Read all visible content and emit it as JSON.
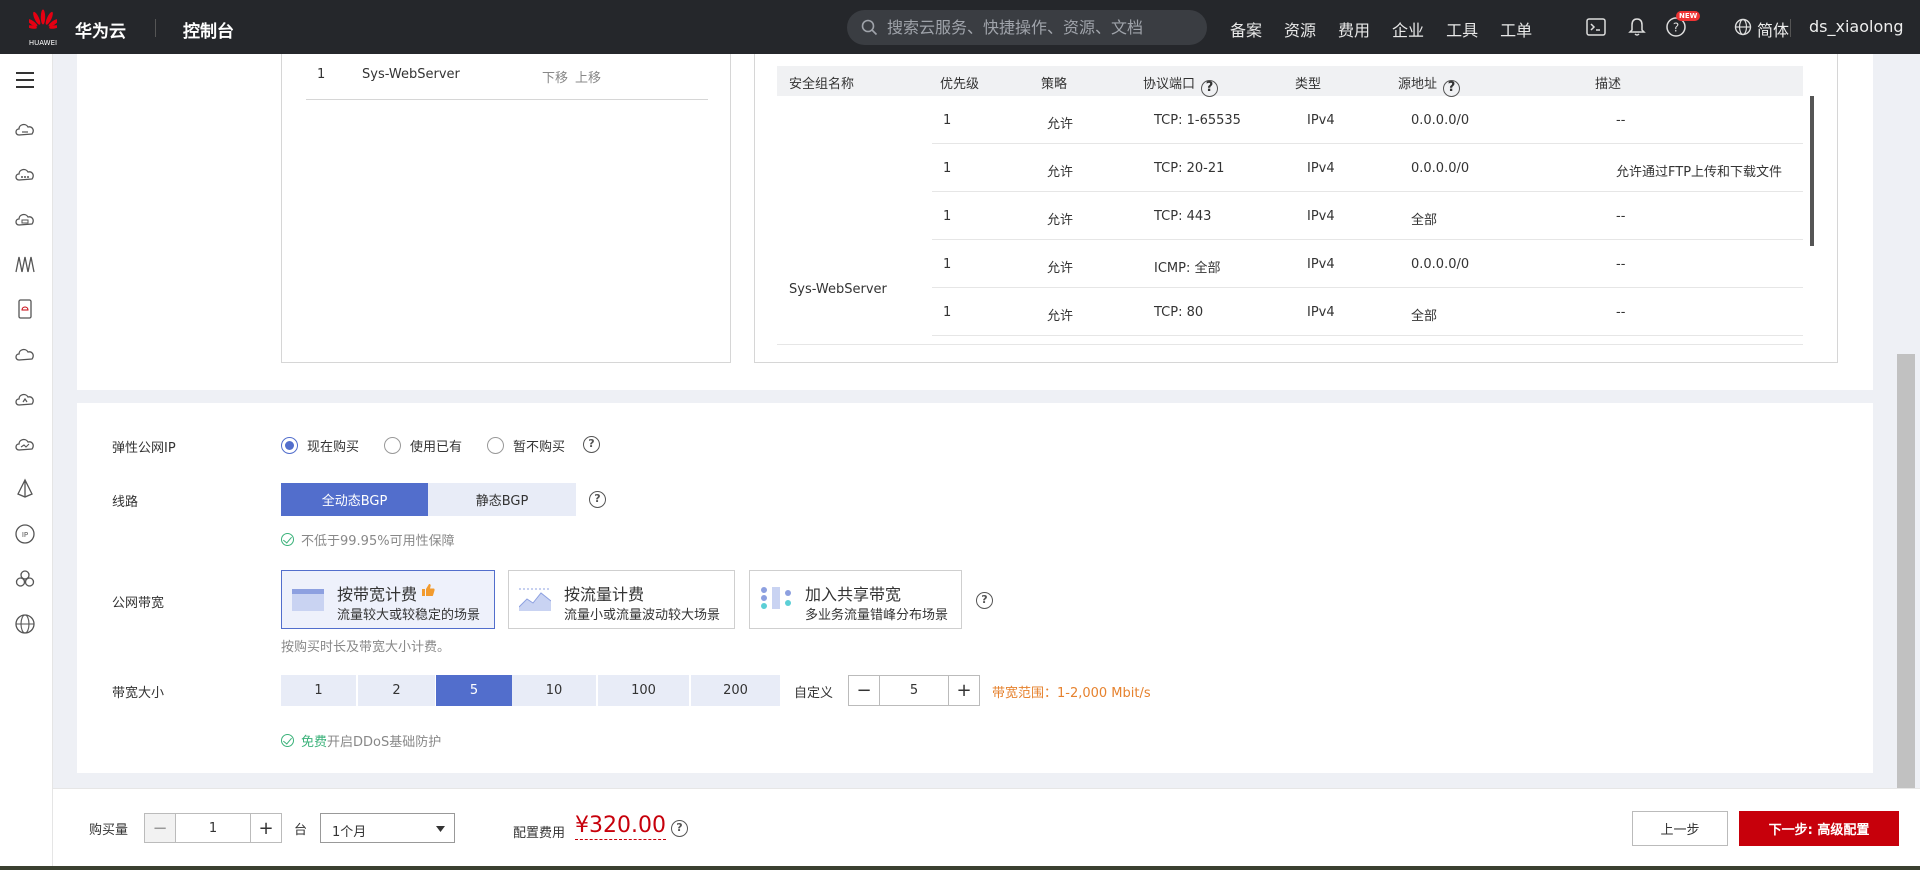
{
  "topbar": {
    "logo_text": "HUAWEI",
    "brand": "华为云",
    "console": "控制台",
    "search_placeholder": "搜索云服务、快捷操作、资源、文档",
    "nav": [
      "备案",
      "资源",
      "费用",
      "企业",
      "工具",
      "工单"
    ],
    "new_badge": "NEW",
    "language": "简体",
    "user": "ds_xiaolong"
  },
  "sidebar": {
    "icons": [
      "menu-icon",
      "cloud-server-icon",
      "cloud-service-icon",
      "cloud-storage-icon",
      "network-icon",
      "database-icon",
      "cloud-icon",
      "cloud-upload-icon",
      "cloud-monitor-icon",
      "deploy-icon",
      "ip-icon",
      "cluster-icon",
      "globe-icon"
    ]
  },
  "security_group_list": {
    "rows": [
      {
        "index": "1",
        "name": "Sys-WebServer",
        "down": "下移",
        "up": "上移"
      }
    ]
  },
  "rules_table": {
    "headers": [
      "安全组名称",
      "优先级",
      "策略",
      "协议端口",
      "类型",
      "源地址",
      "描述"
    ],
    "group_name": "Sys-WebServer",
    "rows": [
      {
        "priority": "1",
        "policy": "允许",
        "port": "TCP: 1-65535",
        "type": "IPv4",
        "source": "0.0.0.0/0",
        "desc": "--"
      },
      {
        "priority": "1",
        "policy": "允许",
        "port": "TCP: 20-21",
        "type": "IPv4",
        "source": "0.0.0.0/0",
        "desc": "允许通过FTP上传和下载文件"
      },
      {
        "priority": "1",
        "policy": "允许",
        "port": "TCP: 443",
        "type": "IPv4",
        "source": "全部",
        "desc": "--"
      },
      {
        "priority": "1",
        "policy": "允许",
        "port": "ICMP: 全部",
        "type": "IPv4",
        "source": "0.0.0.0/0",
        "desc": "--"
      },
      {
        "priority": "1",
        "policy": "允许",
        "port": "TCP: 80",
        "type": "IPv4",
        "source": "全部",
        "desc": "--"
      }
    ]
  },
  "eip": {
    "label": "弹性公网IP",
    "options": [
      "现在购买",
      "使用已有",
      "暂不购买"
    ],
    "selected": "现在购买"
  },
  "line": {
    "label": "线路",
    "options": [
      "全动态BGP",
      "静态BGP"
    ],
    "selected": "全动态BGP",
    "note": "不低于99.95%可用性保障"
  },
  "bandwidth_billing": {
    "label": "公网带宽",
    "options": [
      {
        "title": "按带宽计费",
        "sub": "流量较大或较稳定的场景"
      },
      {
        "title": "按流量计费",
        "sub": "流量小或流量波动较大场景"
      },
      {
        "title": "加入共享带宽",
        "sub": "多业务流量错峰分布场景"
      }
    ],
    "selected": "按带宽计费",
    "note": "按购买时长及带宽大小计费。"
  },
  "bandwidth_size": {
    "label": "带宽大小",
    "options": [
      "1",
      "2",
      "5",
      "10",
      "100",
      "200"
    ],
    "selected": "5",
    "custom_label": "自定义",
    "custom_value": "5",
    "range_text": "带宽范围：1-2,000 Mbit/s",
    "ddos_free": "免费",
    "ddos_text": "开启DDoS基础防护"
  },
  "bottom": {
    "quantity_label": "购买量",
    "quantity": "1",
    "unit": "台",
    "duration": "1个月",
    "fee_label": "配置费用",
    "price": "¥320.00",
    "prev": "上一步",
    "next": "下一步: 高级配置"
  },
  "colors": {
    "accent": "#526ecc",
    "primary_button": "#c7000b",
    "price": "#c7000b",
    "range": "#e6822e",
    "success": "#3bb27a"
  }
}
